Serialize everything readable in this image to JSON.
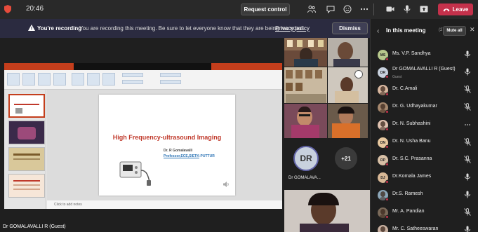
{
  "topbar": {
    "time": "20:46",
    "request_control_label": "Request control",
    "leave_label": "Leave",
    "icon_names": [
      "people-icon",
      "chat-icon",
      "react-icon",
      "more-icon",
      "camera-icon",
      "mic-icon",
      "share-icon"
    ]
  },
  "banner": {
    "title": "You're recording",
    "text": "You are recording this meeting. Be sure to let everyone know that they are being recorded.",
    "link": "Privacy policy",
    "dismiss_label": "Dismiss"
  },
  "slide": {
    "title": "High Frequency-ultrasound Imaging",
    "author": "Dr. R Gomalavalli",
    "affiliation_underlined": "Professor,ECE,SIETK",
    "affiliation_rest": "-PUTTUR",
    "notes_placeholder": "Click to add notes"
  },
  "presenter_label": "Dr GOMALAVALLI R (Guest)",
  "tiles": {
    "dr_initials": "DR",
    "dr_name": "Dr GOMALAVA...",
    "overflow_count": "+21"
  },
  "panel": {
    "title": "In this meeting",
    "count": "(27)",
    "mute_all_label": "Mute all",
    "participants": [
      {
        "name": "Ms. V.P. Sandhya",
        "initials": "MS",
        "sub": "",
        "mic": "mic-on",
        "color": "#b7c88c"
      },
      {
        "name": "Dr GOMALAVALLI R (Guest)",
        "initials": "DR",
        "sub": "Guest",
        "mic": "mic-on",
        "color": "#c8d1de"
      },
      {
        "name": "Dr. C.Amali",
        "initials": "",
        "sub": "",
        "mic": "mic-off",
        "color": "#d9b8a0"
      },
      {
        "name": "Dr. G. Udhayakumar",
        "initials": "",
        "sub": "",
        "mic": "mic-off",
        "color": "#a6886e"
      },
      {
        "name": "Dr. N. Subhashini",
        "initials": "",
        "sub": "",
        "mic": "more",
        "color": "#e0c2b0"
      },
      {
        "name": "Dr. N. Usha Banu",
        "initials": "DN",
        "sub": "",
        "mic": "mic-off",
        "color": "#e8c9a0"
      },
      {
        "name": "Dr. S.C. Prasanna",
        "initials": "DP",
        "sub": "",
        "mic": "mic-off",
        "color": "#d8c0a6"
      },
      {
        "name": "Dr.Komala James",
        "initials": "DJ",
        "sub": "",
        "mic": "mic-on",
        "color": "#d8b896"
      },
      {
        "name": "Dr.S. Ramesh",
        "initials": "",
        "sub": "",
        "mic": "mic-on",
        "color": "#8ca6b8"
      },
      {
        "name": "Mr. A. Pandian",
        "initials": "",
        "sub": "",
        "mic": "mic-off",
        "color": "#7a6a5a"
      },
      {
        "name": "Mr. C. Satheeswaran",
        "initials": "",
        "sub": "",
        "mic": "mic-on",
        "color": "#c8b0a0"
      }
    ]
  },
  "colors": {
    "leave": "#c4314b",
    "banner_bg": "#2b2b40",
    "slide_title": "#c0392b",
    "affiliation": "#2e75b6"
  }
}
